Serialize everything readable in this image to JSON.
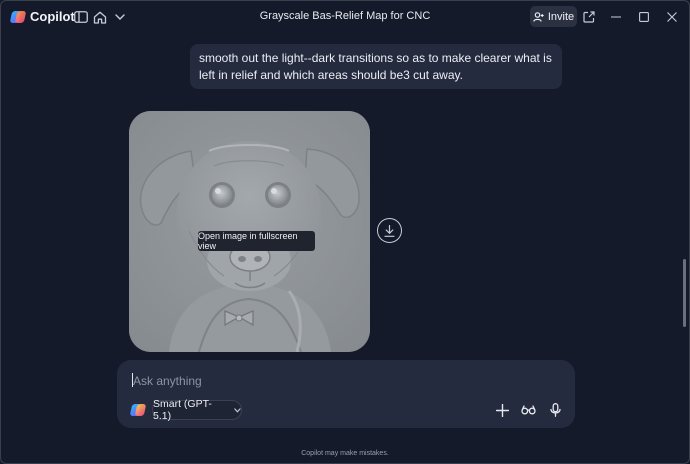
{
  "app": {
    "name": "Copilot"
  },
  "window": {
    "title": "Grayscale Bas-Relief Map for CNC"
  },
  "header": {
    "invite_label": "Invite"
  },
  "chat": {
    "user_message": "smooth out the light--dark transitions so as to make clearer what is left in relief and which areas should be3 cut away.",
    "tooltip": "Open image in fullscreen view"
  },
  "composer": {
    "placeholder": "Ask anything",
    "model_label": "Smart (GPT-5.1)"
  },
  "footer": {
    "disclaimer": "Copilot may make mistakes."
  },
  "colors": {
    "background": "#151a2a",
    "surface": "#252b3e",
    "relief_gray": "#8d9296"
  },
  "icons": [
    "sidebar-toggle-icon",
    "home-icon",
    "chevron-down-icon",
    "invite-person-icon",
    "new-window-icon",
    "minimize-icon",
    "maximize-icon",
    "close-icon",
    "download-icon",
    "plus-icon",
    "glasses-icon",
    "microphone-icon"
  ]
}
